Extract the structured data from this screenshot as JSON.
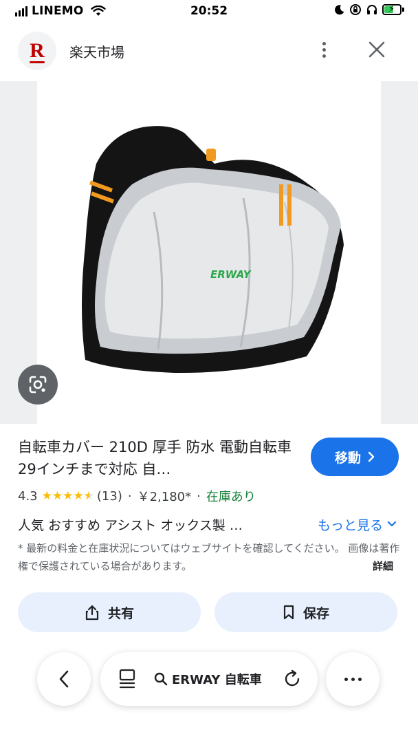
{
  "status_bar": {
    "carrier": "LINEMO",
    "time": "20:52"
  },
  "header": {
    "logo_letter": "R",
    "site_name": "楽天市場"
  },
  "product": {
    "image_brand": "ERWAY",
    "title": "自転車カバー 210D 厚手 防水 電動自転車 29インチまで対応 自…",
    "move_button": "移動",
    "rating": "4.3",
    "rating_value": 4.3,
    "review_count": "(13)",
    "price": "￥2,180*",
    "stock": "在庫あり",
    "tags": "人気 おすすめ アシスト オックス製 …",
    "more_link": "もっと見る",
    "disclaimer": "* 最新の料金と在庫状況についてはウェブサイトを確認してください。 画像は著作権で保護されている場合があります。",
    "disclaimer_more": "詳細"
  },
  "actions": {
    "share": "共有",
    "save": "保存"
  },
  "bottom_nav": {
    "search_query": "ERWAY 自転車"
  },
  "colors": {
    "accent": "#1a73e8",
    "stock": "#188038",
    "star": "#fbbc04",
    "chip_bg": "#e8f0fe",
    "brand_red": "#bf0000"
  }
}
